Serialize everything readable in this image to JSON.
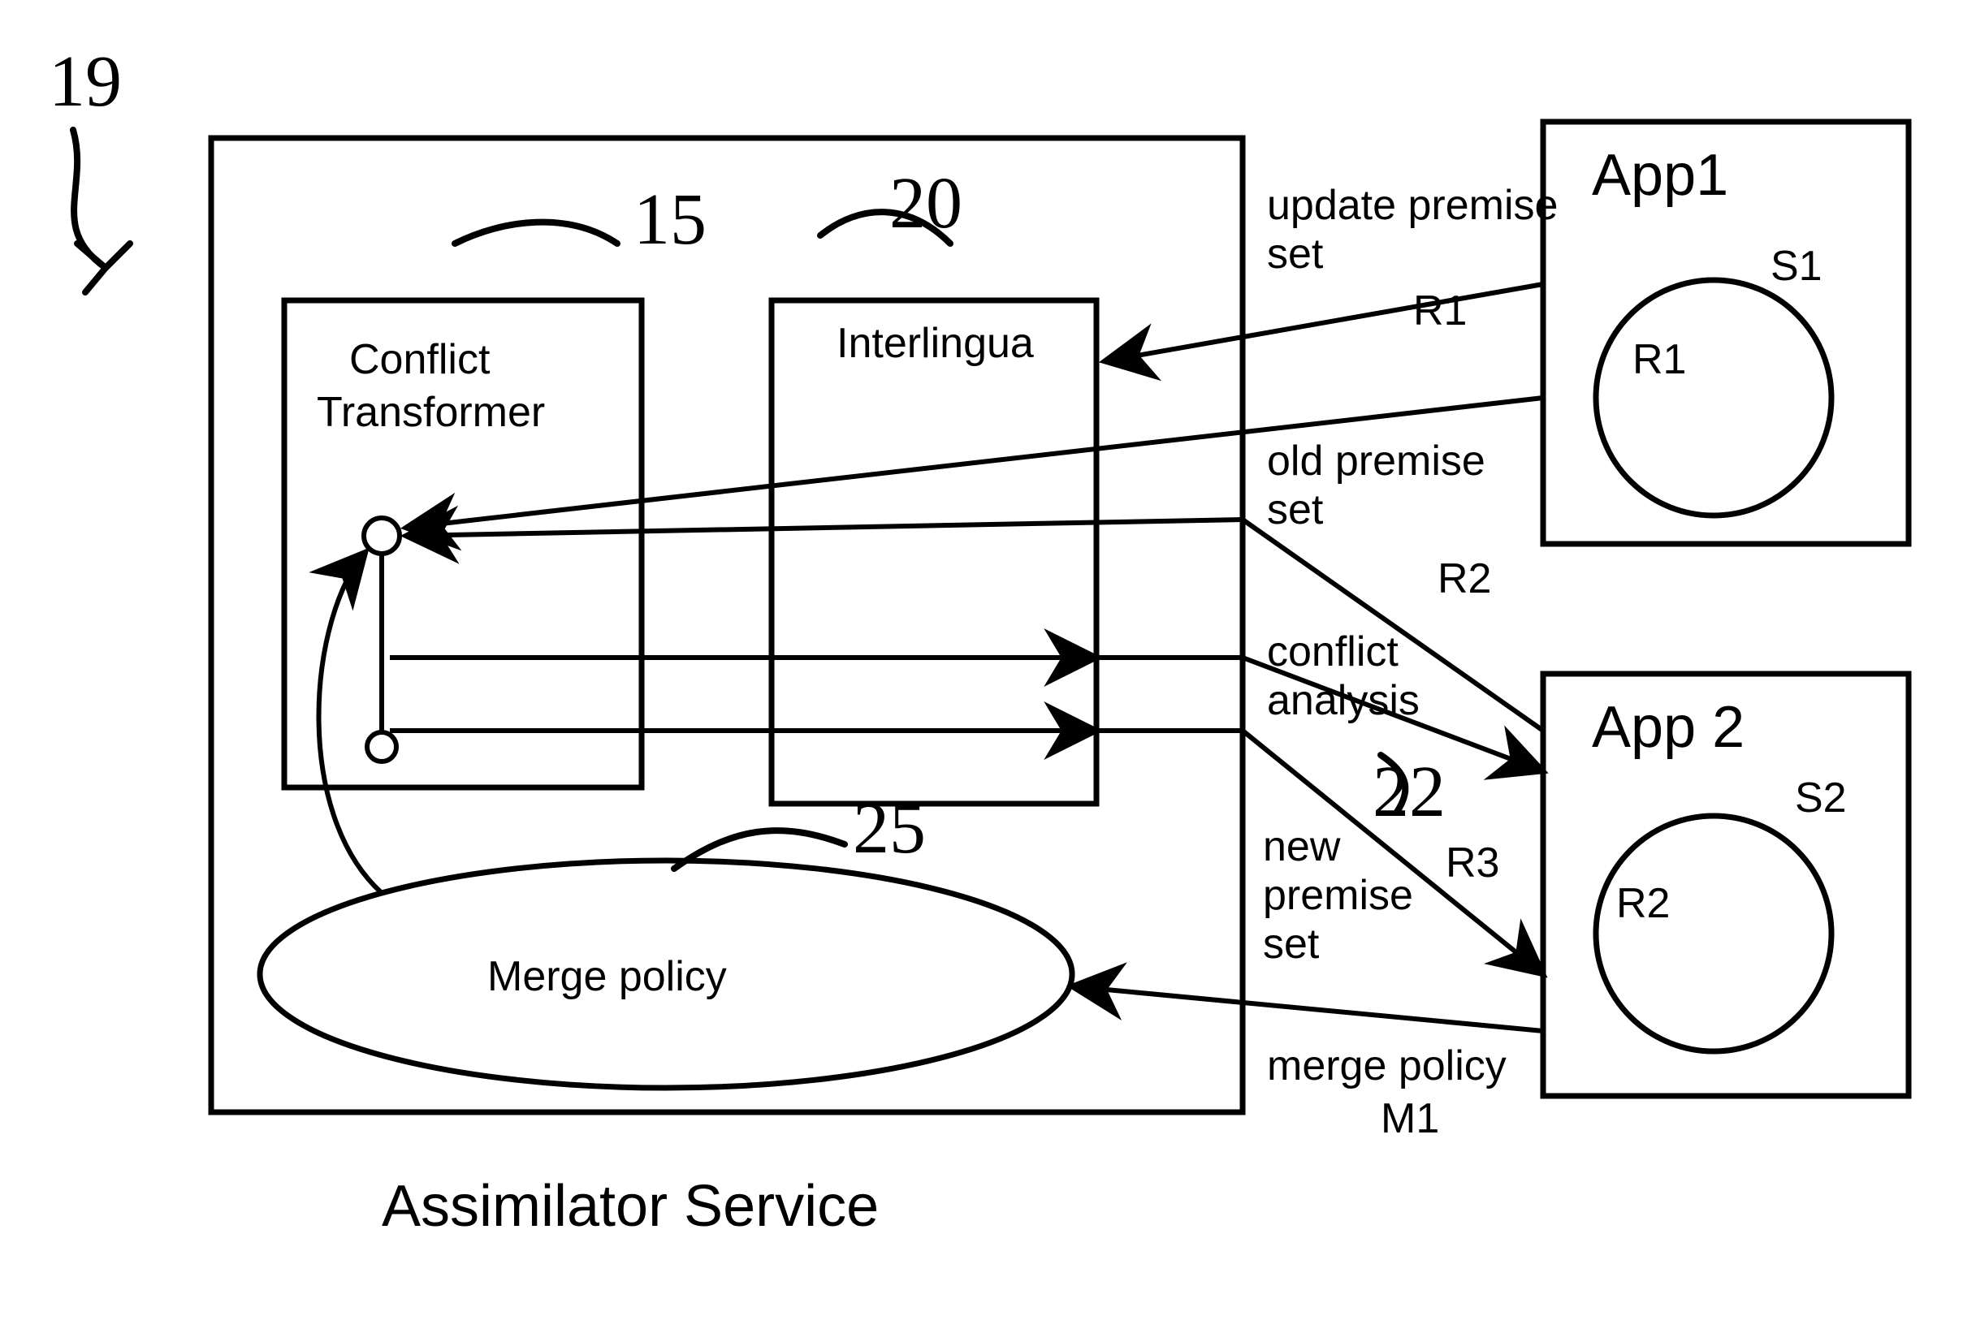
{
  "figure_number": "19",
  "assimilator": {
    "title": "Assimilator Service",
    "conflict_transformer": {
      "label": "Conflict\nTransformer",
      "ref": "15"
    },
    "interlingua": {
      "label": "Interlingua",
      "ref": "20"
    },
    "merge_policy": {
      "label": "Merge policy",
      "ref": "25"
    }
  },
  "apps": {
    "app1": {
      "title": "App1",
      "s_label": "S1",
      "r_label": "R1"
    },
    "app2": {
      "title": "App 2",
      "s_label": "S2",
      "r_label": "R2"
    }
  },
  "arrows": {
    "update_premise": {
      "label": "update premise\nset",
      "r": "R1"
    },
    "old_premise": {
      "label": "old premise\nset",
      "r": "R2"
    },
    "conflict_analysis": {
      "label": "conflict\nanalysis",
      "ref": "22"
    },
    "new_premise": {
      "label": "new\npremise\nset",
      "r": "R3"
    },
    "merge_policy_in": {
      "label": "merge policy\nM1"
    }
  }
}
